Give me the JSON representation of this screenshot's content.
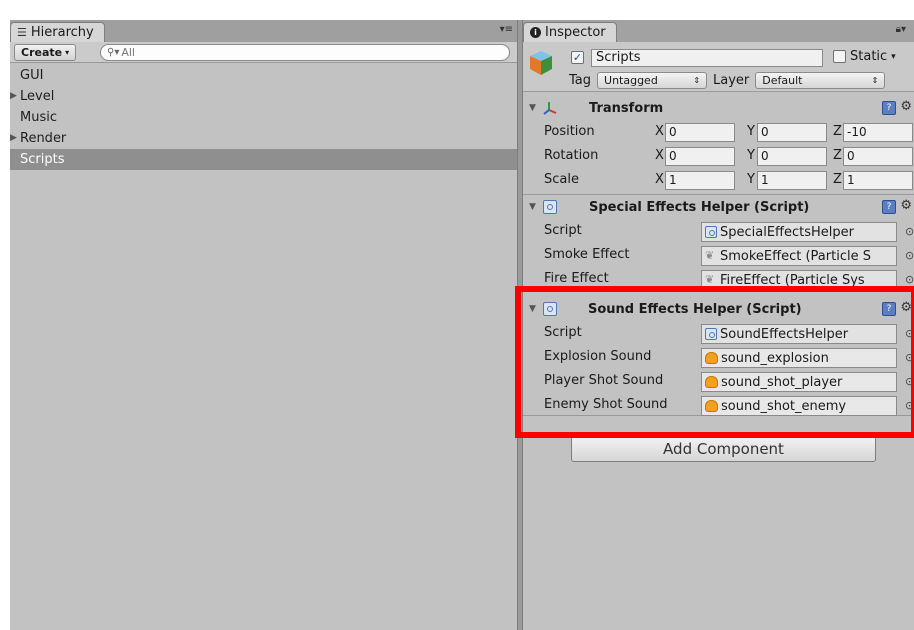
{
  "hierarchy": {
    "tab_label": "Hierarchy",
    "tab_icon": "list-icon",
    "create_label": "Create",
    "search_placeholder": "All",
    "items": [
      {
        "label": "GUI",
        "foldable": false,
        "selected": false
      },
      {
        "label": "Level",
        "foldable": true,
        "selected": false
      },
      {
        "label": "Music",
        "foldable": false,
        "selected": false
      },
      {
        "label": "Render",
        "foldable": true,
        "selected": false
      },
      {
        "label": "Scripts",
        "foldable": false,
        "selected": true
      }
    ]
  },
  "inspector": {
    "tab_label": "Inspector",
    "tab_icon": "info-icon",
    "object": {
      "active": true,
      "name": "Scripts",
      "static_label": "Static",
      "tag_label": "Tag",
      "tag_value": "Untagged",
      "layer_label": "Layer",
      "layer_value": "Default"
    },
    "transform": {
      "title": "Transform",
      "rows": [
        {
          "label": "Position",
          "x": "0",
          "y": "0",
          "z": "-10"
        },
        {
          "label": "Rotation",
          "x": "0",
          "y": "0",
          "z": "0"
        },
        {
          "label": "Scale",
          "x": "1",
          "y": "1",
          "z": "1"
        }
      ],
      "axis_x": "X",
      "axis_y": "Y",
      "axis_z": "Z"
    },
    "special_effects": {
      "title": "Special Effects Helper (Script)",
      "rows": [
        {
          "label": "Script",
          "value": "SpecialEffectsHelper",
          "icon": "script-icon"
        },
        {
          "label": "Smoke Effect",
          "value": "SmokeEffect (Particle S",
          "icon": "particle-icon"
        },
        {
          "label": "Fire Effect",
          "value": "FireEffect (Particle Sys",
          "icon": "particle-icon"
        }
      ]
    },
    "sound_effects": {
      "title": "Sound Effects Helper (Script)",
      "rows": [
        {
          "label": "Script",
          "value": "SoundEffectsHelper",
          "icon": "script-icon"
        },
        {
          "label": "Explosion Sound",
          "value": "sound_explosion",
          "icon": "audio-icon"
        },
        {
          "label": "Player Shot Sound",
          "value": "sound_shot_player",
          "icon": "audio-icon"
        },
        {
          "label": "Enemy Shot Sound",
          "value": "sound_shot_enemy",
          "icon": "audio-icon"
        }
      ]
    },
    "add_component_label": "Add Component"
  },
  "colors": {
    "highlight": "#ff0000",
    "selection": "#8f8f8f",
    "panel": "#c2c2c2"
  }
}
